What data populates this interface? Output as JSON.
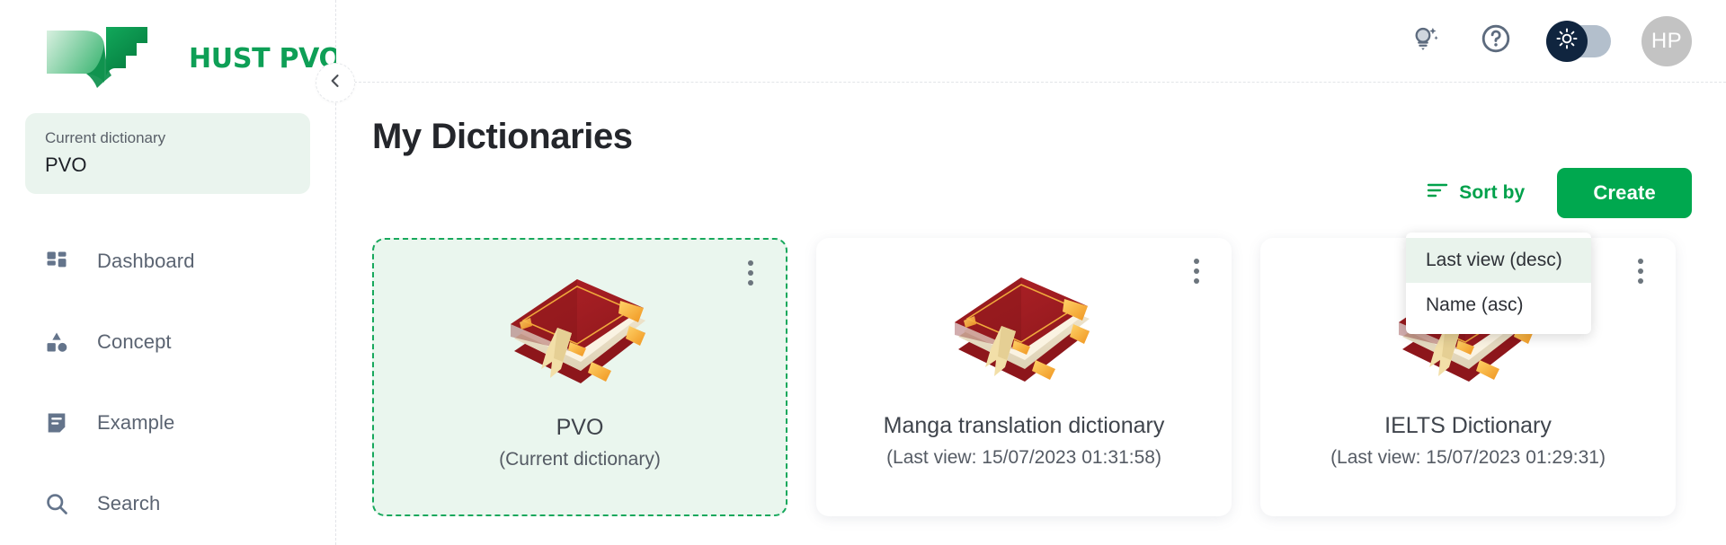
{
  "brand": {
    "name": "HUST PVO",
    "logo_icon": "open-book-logo",
    "accent_green": "#0e9f56"
  },
  "sidebar": {
    "current_dictionary": {
      "label": "Current dictionary",
      "value": "PVO"
    },
    "collapse_icon": "chevron-left-icon",
    "items": [
      {
        "label": "Dashboard",
        "icon": "dashboard-grid-icon"
      },
      {
        "label": "Concept",
        "icon": "shapes-icon"
      },
      {
        "label": "Example",
        "icon": "note-icon"
      },
      {
        "label": "Search",
        "icon": "search-icon"
      }
    ]
  },
  "header": {
    "icons": [
      {
        "name": "lightbulb-idea-icon"
      },
      {
        "name": "help-question-icon"
      }
    ],
    "theme_toggle": {
      "icon": "sun-icon",
      "state": "light",
      "knob_color": "#10253f",
      "track_color": "#b3bfcc"
    },
    "avatar": {
      "initials": "HP",
      "color": "#c3c3c3"
    }
  },
  "main": {
    "title": "My Dictionaries",
    "toolbar": {
      "sort_label": "Sort by",
      "sort_icon": "sort-lines-icon",
      "create_label": "Create",
      "create_color": "#00a84f"
    },
    "sort_menu": {
      "open": true,
      "options": [
        {
          "label": "Last view (desc)",
          "selected": true
        },
        {
          "label": "Name (asc)",
          "selected": false
        }
      ]
    },
    "cards": [
      {
        "title": "PVO",
        "subtitle": "(Current dictionary)",
        "is_current": true,
        "book_icon": "closed-book-icon",
        "menu_icon": "more-vertical-icon"
      },
      {
        "title": "Manga translation dictionary",
        "subtitle": "(Last view: 15/07/2023 01:31:58)",
        "is_current": false,
        "book_icon": "closed-book-icon",
        "menu_icon": "more-vertical-icon"
      },
      {
        "title": "IELTS Dictionary",
        "subtitle": "(Last view: 15/07/2023 01:29:31)",
        "is_current": false,
        "book_icon": "closed-book-icon",
        "menu_icon": "more-vertical-icon"
      }
    ]
  }
}
